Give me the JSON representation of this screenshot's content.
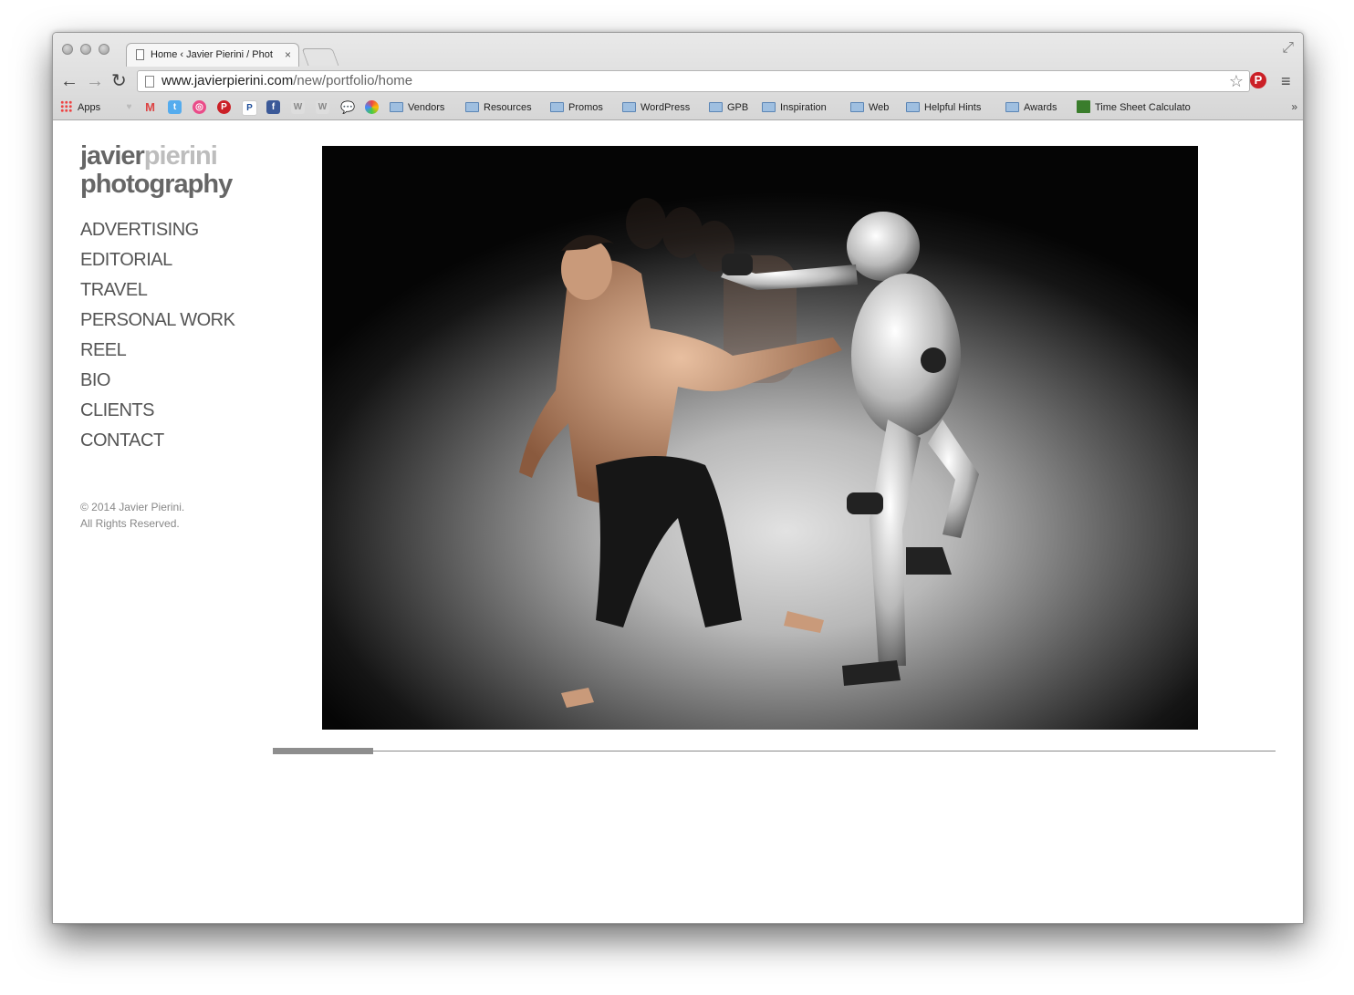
{
  "browser": {
    "tab_title": "Home ‹ Javier Pierini  /  Phot",
    "url_host": "www.javierpierini.com",
    "url_path": "/new/portfolio/home",
    "bookmarks": [
      {
        "label": "Apps"
      },
      {
        "label": "Vendors"
      },
      {
        "label": "Resources"
      },
      {
        "label": "Promos"
      },
      {
        "label": "WordPress"
      },
      {
        "label": "GPB"
      },
      {
        "label": "Inspiration"
      },
      {
        "label": "Web"
      },
      {
        "label": "Helpful Hints"
      },
      {
        "label": "Awards"
      },
      {
        "label": "Time Sheet Calculato"
      }
    ]
  },
  "site": {
    "logo_part1": "javier",
    "logo_part2": "pierini",
    "logo_part3": "photography",
    "nav": [
      "ADVERTISING",
      "EDITORIAL",
      "TRAVEL",
      "PERSONAL WORK",
      "REEL",
      "BIO",
      "CLIENTS",
      "CONTACT"
    ],
    "copyright_line1": "© 2014 Javier Pierini.",
    "copyright_line2": "All Rights Reserved."
  },
  "slideshow": {
    "progress": 0.1
  },
  "colors": {
    "accent_pinterest": "#cb2027",
    "nav_text": "#555555"
  }
}
